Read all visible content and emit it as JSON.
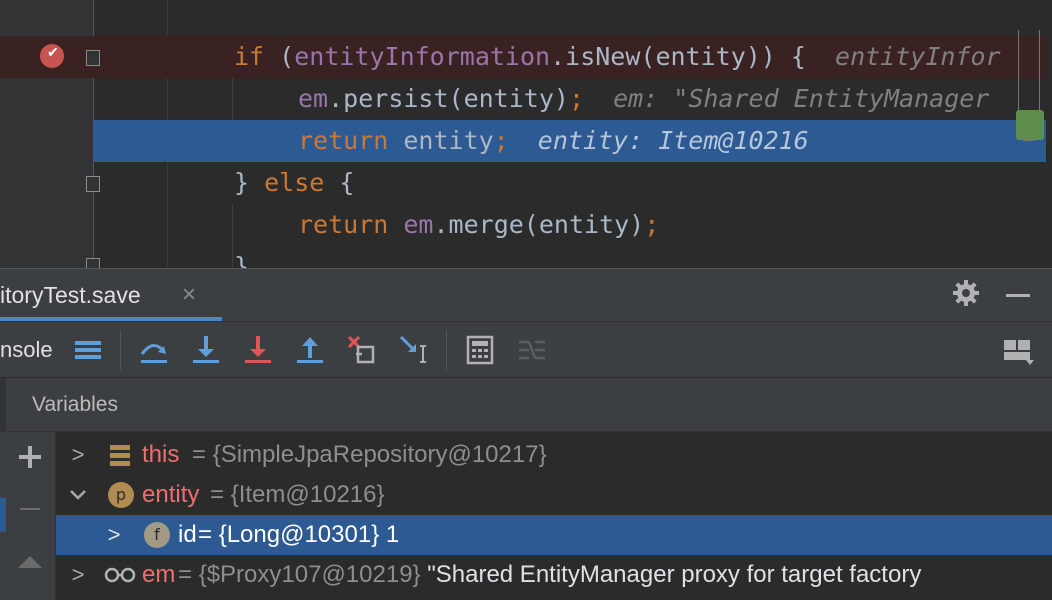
{
  "editor": {
    "lines": [
      {
        "kw": "if",
        "pre": " (",
        "obj": "entityInformation",
        "mid": ".isNew(entity)) {",
        "hint": "entityInfor"
      },
      {
        "obj": "em",
        "mid": ".persist(entity)",
        "semi": ";",
        "hint": "em: \"Shared EntityManager"
      },
      {
        "kw": "return",
        "mid": " entity",
        "semi": ";",
        "hint": "entity: Item@10216"
      },
      {
        "pre": "} ",
        "kw": "else",
        "mid": " {"
      },
      {
        "kw": "return",
        "obj": "em",
        "mid": ".merge(entity)",
        "semi": ";"
      },
      {
        "mid": "}"
      }
    ]
  },
  "tool_window": {
    "tab_label": "itoryTest.save",
    "close_glyph": "×"
  },
  "toolbar": {
    "console_label": "nsole"
  },
  "variables": {
    "title": "Variables",
    "rows": [
      {
        "chevron": ">",
        "name": "this",
        "eq": " = ",
        "value": "{SimpleJpaRepository@10217}"
      },
      {
        "chevron": "v",
        "badge": "p",
        "name": "entity",
        "eq": " = ",
        "value": "{Item@10216}"
      },
      {
        "chevron": ">",
        "badge": "f",
        "name": "id",
        "eq": " = ",
        "value": "{Long@10301} 1"
      },
      {
        "chevron": ">",
        "name": "em",
        "eq": " = ",
        "value": "{$Proxy107@10219}",
        "extra": " \"Shared EntityManager proxy for target factory"
      }
    ]
  },
  "colors": {
    "accent": "#2d5a92",
    "keyword": "#cc7832",
    "field": "#9876aa",
    "var_name": "#ef6f6c"
  },
  "icons": {
    "toolbar": [
      "list-icon",
      "step-over-icon",
      "step-into-icon",
      "force-step-into-icon",
      "step-out-icon",
      "drop-frame-icon",
      "run-to-cursor-icon",
      "evaluate-icon",
      "trace-icon",
      "layout-icon"
    ]
  }
}
